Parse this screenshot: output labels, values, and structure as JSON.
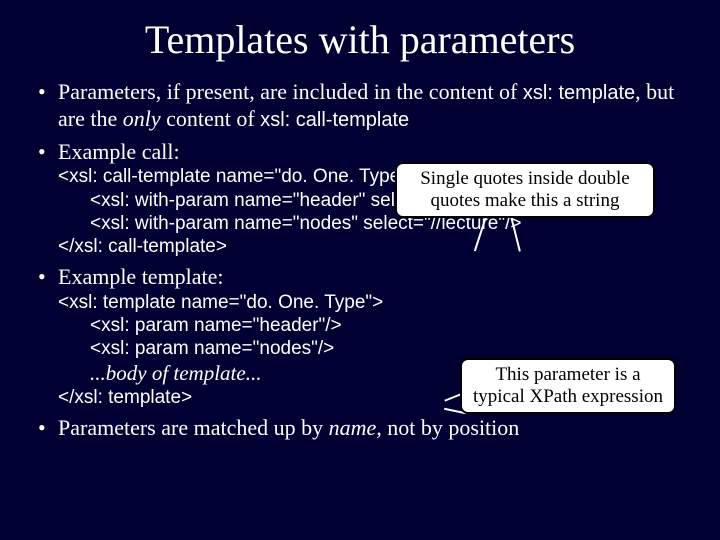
{
  "title": "Templates with parameters",
  "bullets": {
    "b1_a": "Parameters, if present, are included in the content of ",
    "b1_code1": "xsl: template",
    "b1_b": ", but are the ",
    "b1_only": "only",
    "b1_c": " content of ",
    "b1_code2": "xsl: call-template",
    "b2": "Example call:",
    "b3": "Example template:",
    "b4_a": "Parameters are matched up by ",
    "b4_name": "name,",
    "b4_b": " not by position"
  },
  "code1": {
    "l1": "<xsl: call-template name=\"do. One. Type\">",
    "l2": "<xsl: with-param name=\"header\" select=\"'Lectures'\"/>",
    "l3": "<xsl: with-param name=\"nodes\" select=\"//lecture\"/>",
    "l4": "</xsl: call-template>"
  },
  "code2": {
    "l1": "<xsl: template name=\"do. One. Type\">",
    "l2": "<xsl: param name=\"header\"/>",
    "l3": "<xsl: param name=\"nodes\"/>",
    "l4": "...body of template...",
    "l5": "</xsl: template>"
  },
  "callouts": {
    "c1l1": "Single quotes inside double",
    "c1l2": "quotes make this a string",
    "c2l1": "This parameter is a",
    "c2l2": "typical XPath expression"
  }
}
